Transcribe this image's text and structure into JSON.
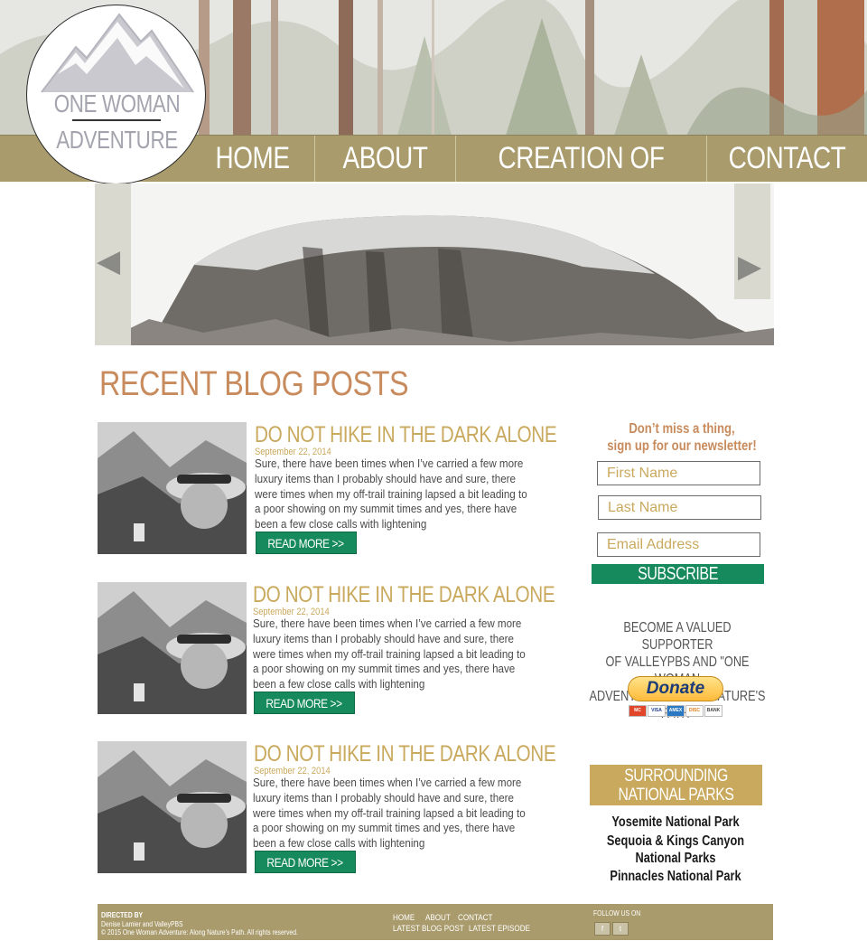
{
  "logo": {
    "line1": "ONE WOMAN",
    "line2": "ADVENTURE"
  },
  "nav": {
    "items": [
      {
        "label": "HOME"
      },
      {
        "label": "ABOUT"
      },
      {
        "label": "CREATION OF OWA"
      },
      {
        "label": "CONTACT"
      }
    ]
  },
  "slider": {
    "prev_icon": "triangle-left-icon",
    "next_icon": "triangle-right-icon",
    "prev_glyph": "◀",
    "next_glyph": "▶"
  },
  "recent": {
    "title": "RECENT BLOG POSTS"
  },
  "posts": [
    {
      "title": "DO NOT HIKE IN THE DARK ALONE",
      "date": "September 22, 2014",
      "excerpt": "Sure, there have been times when I’ve carried a few more luxury items than I probably should have and sure, there were times when my off-trail training lapsed a bit leading to a poor showing on my summit times and yes, there have been a few close calls with lightening",
      "read_more": "READ MORE >>"
    },
    {
      "title": "DO NOT HIKE IN THE DARK ALONE",
      "date": "September 22, 2014",
      "excerpt": "Sure, there have been times when I’ve carried a few more luxury items than I probably should have and sure, there were times when my off-trail training lapsed a bit leading to a poor showing on my summit times and yes, there have been a few close calls with lightening",
      "read_more": "READ MORE >>"
    },
    {
      "title": "DO NOT HIKE IN THE DARK ALONE",
      "date": "September 22, 2014",
      "excerpt": "Sure, there have been times when I’ve carried a few more luxury items than I probably should have and sure, there were times when my off-trail training lapsed a bit leading to a poor showing on my summit times and yes, there have been a few close calls with lightening",
      "read_more": "READ MORE >>"
    }
  ],
  "newsletter": {
    "heading_line1": "Don’t miss a thing,",
    "heading_line2": "sign up for our newsletter!",
    "first_name_placeholder": "First Name",
    "last_name_placeholder": "Last Name",
    "email_placeholder": "Email Address",
    "subscribe_label": "SUBSCRIBE"
  },
  "supporter": {
    "text": "BECOME A VALUED SUPPORTER\nOF VALLEYPBS AND \"ONE WOMAN\nADVENTURE: ALONG NATURE'S PATH\"",
    "donate_label": "Donate",
    "cards": [
      "MC",
      "VISA",
      "AMEX",
      "DISC",
      "BANK"
    ]
  },
  "parks": {
    "header_line1": "SURROUNDING",
    "header_line2": "NATIONAL PARKS",
    "links": [
      "Yosemite National Park",
      "Sequoia & Kings Canyon",
      "National Parks",
      "Pinnacles National Park"
    ]
  },
  "footer": {
    "directed_by": "DIRECTED BY",
    "credits": "Denise Lamier and ValleyPBS",
    "copyright": "© 2015 One Woman Adventure: Along Nature's Path. All rights reserved.",
    "links_row1": [
      "HOME",
      "ABOUT",
      "CONTACT"
    ],
    "links_row2": [
      "LATEST BLOG POST",
      "LATEST EPISODE"
    ],
    "follow_label": "FOLLOW US ON",
    "social": [
      {
        "icon": "facebook-icon",
        "glyph": "f"
      },
      {
        "icon": "twitter-icon",
        "glyph": "t"
      }
    ]
  },
  "colors": {
    "nav_bg": "#a99b6c",
    "title_orange": "#c88b5d",
    "post_gold": "#c9a95d",
    "button_green": "#168a5c"
  }
}
